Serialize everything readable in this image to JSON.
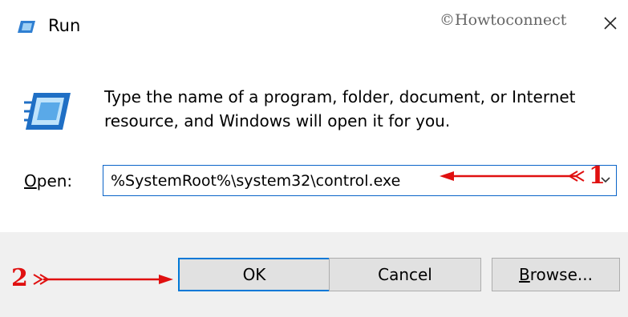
{
  "window": {
    "title": "Run",
    "watermark": "©Howtoconnect"
  },
  "dialog": {
    "description": "Type the name of a program, folder, document, or Internet resource, and Windows will open it for you.",
    "open_label_mnemonic": "O",
    "open_label_rest": "pen:",
    "open_value": "%SystemRoot%\\system32\\control.exe"
  },
  "buttons": {
    "ok": "OK",
    "cancel": "Cancel",
    "browse_mnemonic": "B",
    "browse_rest": "rowse..."
  },
  "annotations": {
    "marker1": "1",
    "marker2": "2"
  },
  "icons": {
    "run_small": "run-icon",
    "run_large": "run-icon",
    "close": "close-icon",
    "dropdown": "chevron-down-icon"
  },
  "colors": {
    "accent": "#0078d7",
    "annotation": "#e01010",
    "footer_bg": "#f0f0f0"
  }
}
